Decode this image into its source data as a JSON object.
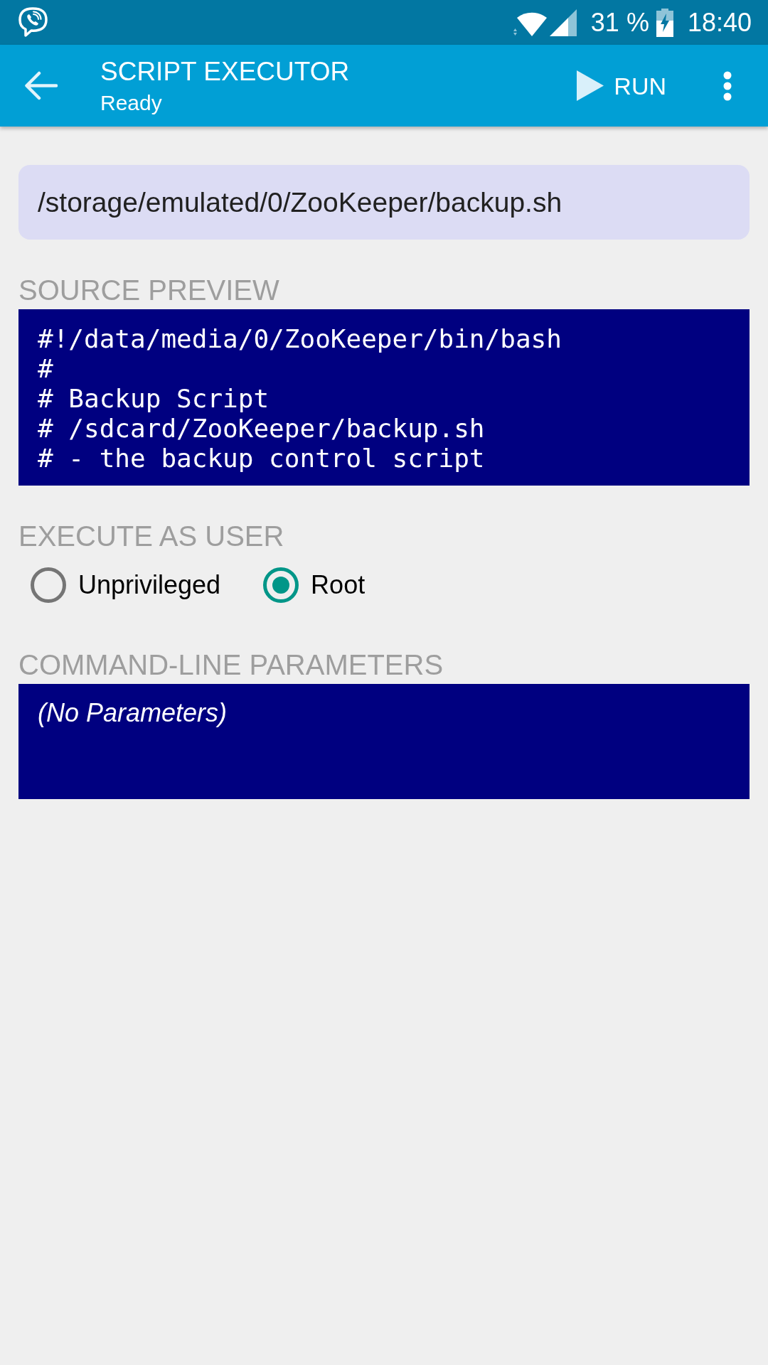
{
  "status_bar": {
    "battery_percent": "31 %",
    "time": "18:40"
  },
  "app_bar": {
    "title": "SCRIPT EXECUTOR",
    "subtitle": "Ready",
    "run_button": {
      "label": "RUN"
    }
  },
  "script_path": {
    "value": "/storage/emulated/0/ZooKeeper/backup.sh"
  },
  "source_preview": {
    "heading": "SOURCE PREVIEW",
    "lines": [
      "#!/data/media/0/ZooKeeper/bin/bash",
      "#",
      "# Backup Script",
      "# /sdcard/ZooKeeper/backup.sh",
      "# - the backup control script"
    ]
  },
  "execute_as": {
    "heading": "EXECUTE AS USER",
    "options": [
      {
        "label": "Unprivileged",
        "selected": false
      },
      {
        "label": "Root",
        "selected": true
      }
    ]
  },
  "parameters": {
    "heading": "COMMAND-LINE PARAMETERS",
    "placeholder": "(No Parameters)"
  }
}
